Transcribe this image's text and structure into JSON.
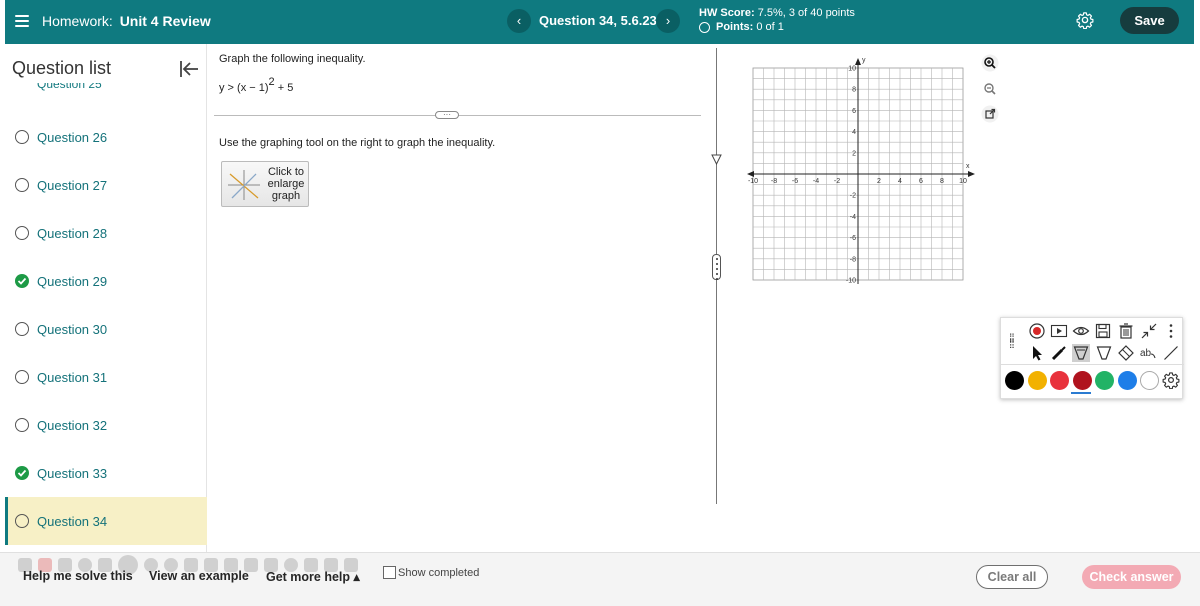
{
  "header": {
    "homework_prefix": "Homework:",
    "homework_name": "Unit 4 Review",
    "prev_label": "‹",
    "next_label": "›",
    "question_label": "Question 34, 5.6.23",
    "hw_score_label": "HW Score:",
    "hw_score_value": "7.5%, 3 of 40 points",
    "points_label": "Points:",
    "points_value": "0 of 1",
    "save_label": "Save",
    "accent_color": "#0f7a80"
  },
  "sidebar": {
    "title": "Question list",
    "partial_item": "Question 25",
    "items": [
      {
        "label": "Question 26",
        "status": "unanswered"
      },
      {
        "label": "Question 27",
        "status": "unanswered"
      },
      {
        "label": "Question 28",
        "status": "unanswered"
      },
      {
        "label": "Question 29",
        "status": "correct"
      },
      {
        "label": "Question 30",
        "status": "unanswered"
      },
      {
        "label": "Question 31",
        "status": "unanswered"
      },
      {
        "label": "Question 32",
        "status": "unanswered"
      },
      {
        "label": "Question 33",
        "status": "correct"
      },
      {
        "label": "Question 34",
        "status": "current"
      }
    ]
  },
  "question": {
    "prompt": "Graph the following inequality.",
    "formula_lhs": "y > (x − 1)",
    "formula_exp": "2",
    "formula_rhs": " + 5",
    "divider_handle": "···",
    "instruction": "Use the graphing tool on the right to graph the inequality.",
    "enlarge_label": "Click to enlarge graph"
  },
  "graph": {
    "x_label": "x",
    "y_label": "y",
    "x_range": [
      -10,
      10
    ],
    "y_range": [
      -10,
      10
    ],
    "grid_step": 1,
    "x_ticks": [
      "-10",
      "-8",
      "-6",
      "-4",
      "-2",
      "2",
      "4",
      "6",
      "8",
      "10"
    ],
    "y_ticks": [
      "10",
      "8",
      "6",
      "4",
      "2",
      "-2",
      "-4",
      "-6",
      "-8",
      "-10"
    ]
  },
  "drawing_tools": {
    "row1_icons": [
      "record-icon",
      "screen-icon",
      "eye-icon",
      "save-icon",
      "trash-icon",
      "collapse-arrows-icon",
      "more-vertical-icon"
    ],
    "row2_icons": [
      "pointer-icon",
      "marker-icon",
      "highlighter-icon",
      "pen-icon",
      "eraser-icon",
      "text-icon",
      "line-icon"
    ],
    "colors": [
      "#000000",
      "#f2b100",
      "#e8323c",
      "#b0131e",
      "#22b366",
      "#1e7ee8",
      "#ffffff"
    ],
    "selected_color_index": 3
  },
  "bottom": {
    "help_label": "Help me solve this",
    "example_label": "View an example",
    "more_help_label": "Get more help ▴",
    "show_completed_label": "Show completed",
    "clear_label": "Clear all",
    "check_label": "Check answer"
  }
}
